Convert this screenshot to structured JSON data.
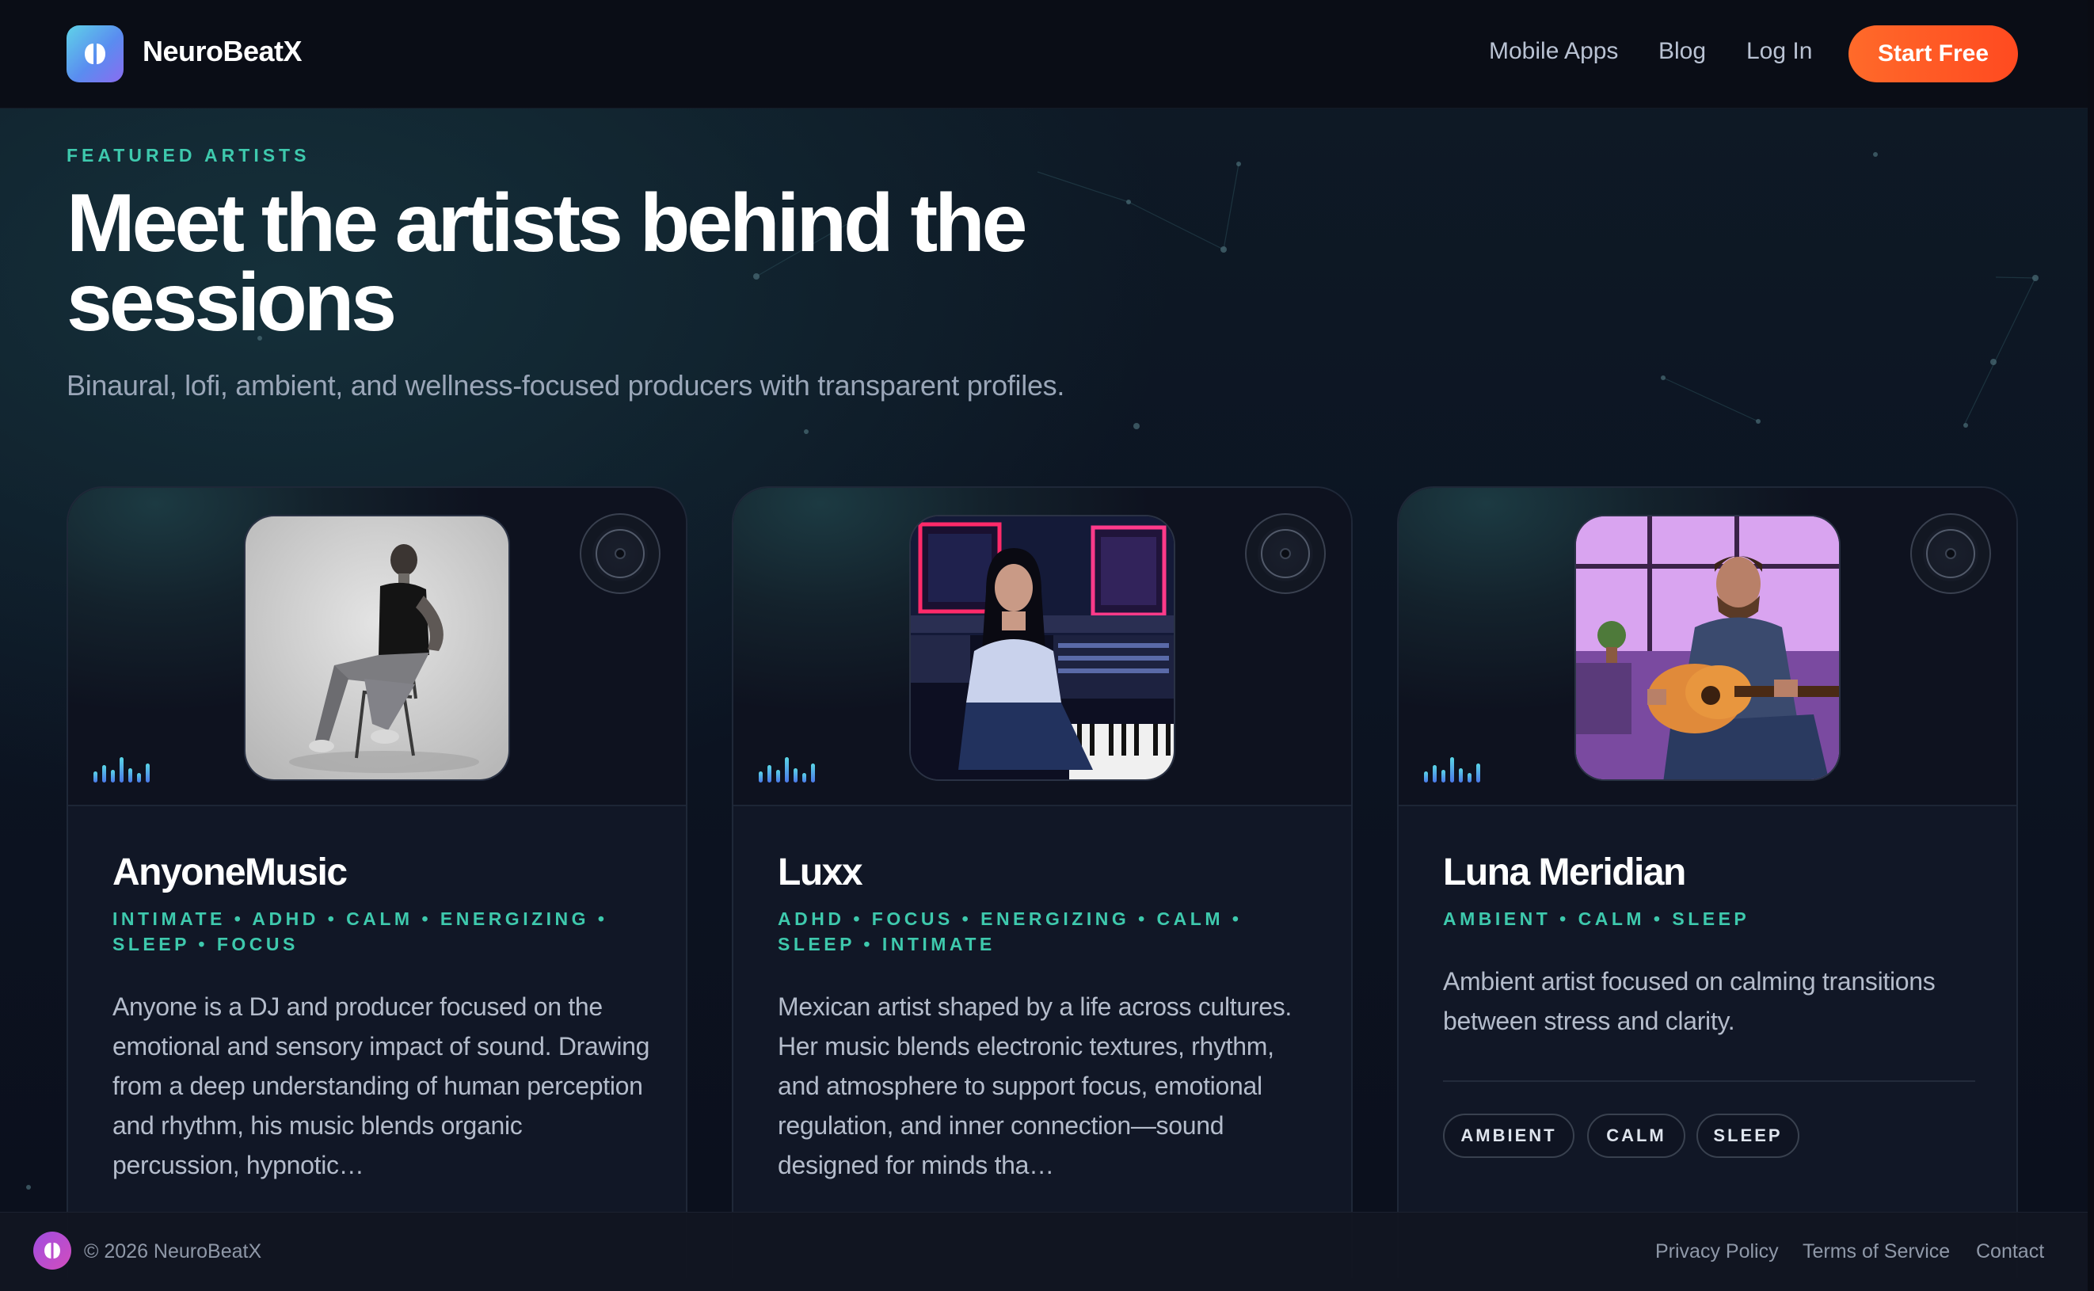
{
  "header": {
    "brand": "NeuroBeatX",
    "nav": [
      {
        "label": "Mobile Apps"
      },
      {
        "label": "Blog"
      },
      {
        "label": "Log In"
      }
    ],
    "cta": "Start Free"
  },
  "hero": {
    "eyebrow": "FEATURED ARTISTS",
    "title": "Meet the artists behind the sessions",
    "subtitle": "Binaural, lofi, ambient, and wellness-focused producers with transparent profiles."
  },
  "artists": [
    {
      "name": "AnyoneMusic",
      "tags_line": "INTIMATE • ADHD • CALM • ENERGIZING • SLEEP • FOCUS",
      "bio": "Anyone is a DJ and producer focused on the emotional and sensory impact of sound. Drawing from a deep understanding of human perception and rhythm, his music blends organic percussion, hypnotic…"
    },
    {
      "name": "Luxx",
      "tags_line": "ADHD • FOCUS • ENERGIZING • CALM • SLEEP • INTIMATE",
      "bio": "Mexican artist shaped by a life across cultures. Her music blends electronic textures, rhythm, and atmosphere to support focus, emotional regulation, and inner connection—sound designed for minds tha…"
    },
    {
      "name": "Luna Meridian",
      "tags_line": "AMBIENT • CALM • SLEEP",
      "bio": "Ambient artist focused on calming transitions between stress and clarity.",
      "pills": [
        "AMBIENT",
        "CALM",
        "SLEEP"
      ]
    }
  ],
  "footer": {
    "copyright": "© 2026 NeuroBeatX",
    "links": [
      "Privacy Policy",
      "Terms of Service",
      "Contact"
    ]
  },
  "colors": {
    "accent": "#3ec9ad",
    "cta": "#ff5a24",
    "background": "#0b0f1c"
  }
}
